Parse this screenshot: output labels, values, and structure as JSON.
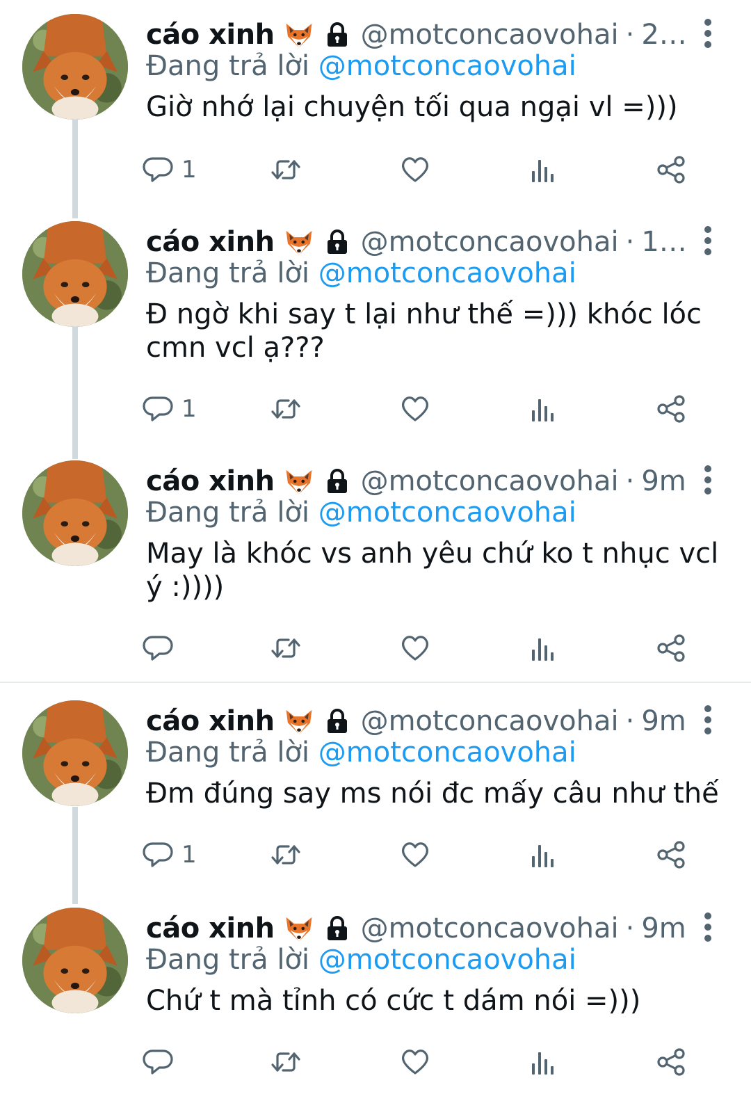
{
  "mention_prefix": "Đang trả lời",
  "tweets": [
    {
      "name": "cáo xinh",
      "handle": "@motconcaovohai",
      "time": "2…",
      "reply_to": "@motconcaovohai",
      "text": "Giờ nhớ lại chuyện tối qua ngại vl =)))",
      "reply_count": "1"
    },
    {
      "name": "cáo xinh",
      "handle": "@motconcaovohai",
      "time": "1…",
      "reply_to": "@motconcaovohai",
      "text": "Đ ngờ khi say t lại như thế =))) khóc lóc cmn vcl ạ???",
      "reply_count": "1"
    },
    {
      "name": "cáo xinh",
      "handle": "@motconcaovohai",
      "time": "9m",
      "reply_to": "@motconcaovohai",
      "text": "May là khóc vs anh yêu chứ ko t nhục vcl ý :))))",
      "reply_count": ""
    },
    {
      "name": "cáo xinh",
      "handle": "@motconcaovohai",
      "time": "9m",
      "reply_to": "@motconcaovohai",
      "text": "Đm đúng say ms nói đc mấy câu như thế",
      "reply_count": "1"
    },
    {
      "name": "cáo xinh",
      "handle": "@motconcaovohai",
      "time": "9m",
      "reply_to": "@motconcaovohai",
      "text": "Chứ t mà tỉnh có cức t dám nói =)))",
      "reply_count": ""
    }
  ],
  "icons": {
    "reply": "reply-icon",
    "retweet": "retweet-icon",
    "like": "heart-icon",
    "views": "analytics-icon",
    "share": "share-icon",
    "more": "more-vertical-icon",
    "lock": "lock-icon",
    "emoji": "fox-emoji-icon"
  },
  "colors": {
    "primary_text": "#0f1419",
    "secondary_text": "#536471",
    "link": "#1d9bf0",
    "thread_line": "#cfd9de"
  }
}
